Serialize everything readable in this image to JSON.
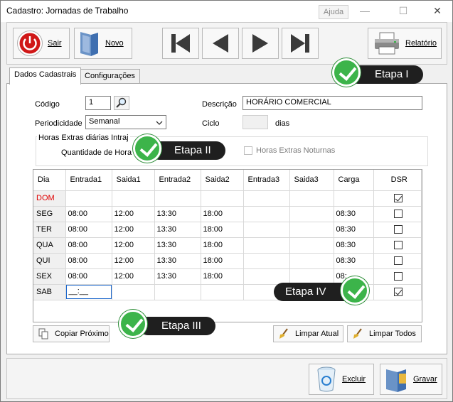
{
  "window": {
    "title": "Cadastro: Jornadas de Trabalho",
    "help_label": "Ajuda"
  },
  "toolbar": {
    "exit_label": "Sair",
    "new_label": "Novo",
    "report_label": "Relatório"
  },
  "tabs": [
    {
      "label": "Dados Cadastrais"
    },
    {
      "label": "Configurações"
    }
  ],
  "form": {
    "code_label": "Código",
    "code_value": "1",
    "description_label": "Descrição",
    "description_value": "HORÁRIO COMERCIAL",
    "periodicity_label": "Periodicidade",
    "periodicity_value": "Semanal",
    "cycle_label": "Ciclo",
    "cycle_value": "",
    "cycle_unit": "dias",
    "overtime_group_label": "Horas Extras diárias Intraj",
    "overtime_quantity_label": "Quantidade de Hora",
    "night_overtime_label": "Horas Extras Noturnas"
  },
  "grid": {
    "headers": [
      "Dia",
      "Entrada1",
      "Saida1",
      "Entrada2",
      "Saida2",
      "Entrada3",
      "Saida3",
      "Carga",
      "DSR"
    ],
    "rows": [
      {
        "day": "DOM",
        "e1": "",
        "s1": "",
        "e2": "",
        "s2": "",
        "e3": "",
        "s3": "",
        "carga": "",
        "dsr": true
      },
      {
        "day": "SEG",
        "e1": "08:00",
        "s1": "12:00",
        "e2": "13:30",
        "s2": "18:00",
        "e3": "",
        "s3": "",
        "carga": "08:30",
        "dsr": false
      },
      {
        "day": "TER",
        "e1": "08:00",
        "s1": "12:00",
        "e2": "13:30",
        "s2": "18:00",
        "e3": "",
        "s3": "",
        "carga": "08:30",
        "dsr": false
      },
      {
        "day": "QUA",
        "e1": "08:00",
        "s1": "12:00",
        "e2": "13:30",
        "s2": "18:00",
        "e3": "",
        "s3": "",
        "carga": "08:30",
        "dsr": false
      },
      {
        "day": "QUI",
        "e1": "08:00",
        "s1": "12:00",
        "e2": "13:30",
        "s2": "18:00",
        "e3": "",
        "s3": "",
        "carga": "08:30",
        "dsr": false
      },
      {
        "day": "SEX",
        "e1": "08:00",
        "s1": "12:00",
        "e2": "13:30",
        "s2": "18:00",
        "e3": "",
        "s3": "",
        "carga": "08:",
        "dsr": false
      },
      {
        "day": "SAB",
        "e1": "__:__",
        "s1": "",
        "e2": "",
        "s2": "",
        "e3": "",
        "s3": "",
        "carga": "",
        "dsr": true
      }
    ]
  },
  "buttons": {
    "copy_next": "Copiar Próximo",
    "clear_current": "Limpar Atual",
    "clear_all": "Limpar Todos",
    "delete": "Excluir",
    "save": "Gravar"
  },
  "callouts": {
    "step1": "Etapa I",
    "step2": "Etapa II",
    "step3": "Etapa III",
    "step4": "Etapa IV"
  },
  "colors": {
    "accent_green": "#3cb44a",
    "callout_bg": "#1f1f1f",
    "sunday_red": "#e00000"
  }
}
